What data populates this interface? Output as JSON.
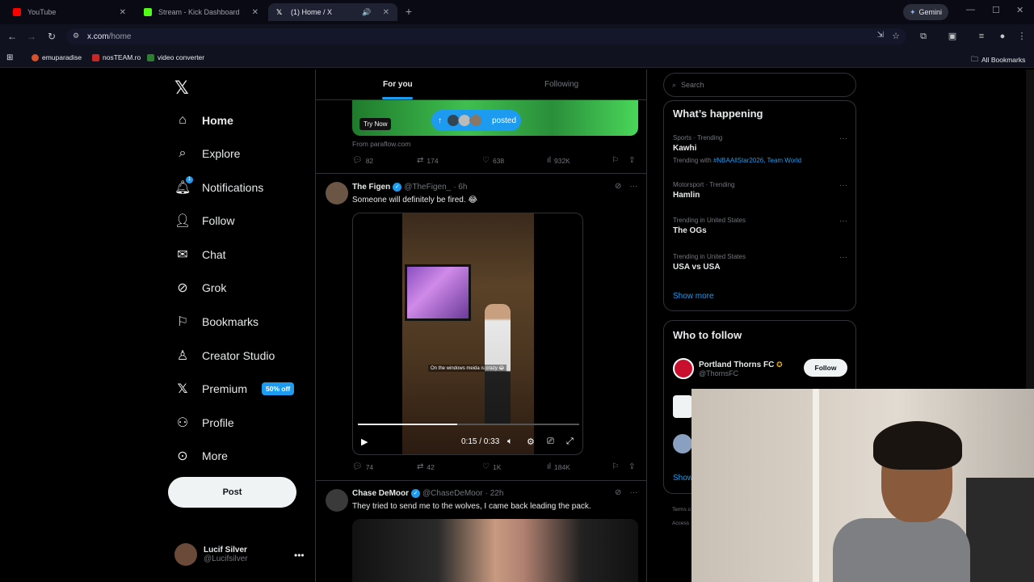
{
  "browser": {
    "tabs": [
      {
        "title": "YouTube",
        "fav_color": "#ff0000"
      },
      {
        "title": "Stream - Kick Dashboard",
        "fav_color": "#53fc18"
      },
      {
        "title": "(1) Home / X",
        "fav_color": "#ffffff"
      }
    ],
    "gemini_label": "Gemini",
    "url_host": "x.com",
    "url_path": "/home",
    "bookmarks": [
      "emuparadise",
      "nosTEAM.ro",
      "video converter"
    ],
    "all_bookmarks": "All Bookmarks"
  },
  "nav": {
    "items": [
      {
        "label": "Home",
        "icon": "home-icon"
      },
      {
        "label": "Explore",
        "icon": "search-icon"
      },
      {
        "label": "Notifications",
        "icon": "bell-icon",
        "badge": "1"
      },
      {
        "label": "Follow",
        "icon": "add-person-icon"
      },
      {
        "label": "Chat",
        "icon": "mail-icon"
      },
      {
        "label": "Grok",
        "icon": "grok-icon"
      },
      {
        "label": "Bookmarks",
        "icon": "bookmark-icon"
      },
      {
        "label": "Creator Studio",
        "icon": "creator-icon"
      },
      {
        "label": "Premium",
        "icon": "x-logo-icon",
        "promo": "50% off"
      },
      {
        "label": "Profile",
        "icon": "person-icon"
      },
      {
        "label": "More",
        "icon": "more-circle-icon"
      }
    ],
    "post_label": "Post",
    "account": {
      "name": "Lucif Silver",
      "handle": "@Lucifsilver"
    }
  },
  "feed": {
    "tabs": [
      "For you",
      "Following"
    ],
    "ad": {
      "try_now": "Try Now",
      "posted_label": "posted",
      "from": "From paraflow.com",
      "stats": {
        "replies": "82",
        "reposts": "174",
        "likes": "638",
        "views": "932K"
      }
    },
    "tweet1": {
      "name": "The Figen",
      "handle": "@TheFigen_",
      "time": "· 6h",
      "text": "Someone will definitely be fired. 😂",
      "video_caption": "On the windows meida is crazy 😂",
      "video_time": "0:15 / 0:33",
      "video_progress": 0.45,
      "stats": {
        "replies": "74",
        "reposts": "42",
        "likes": "1K",
        "views": "184K"
      }
    },
    "tweet2": {
      "name": "Chase DeMoor",
      "handle": "@ChaseDeMoor",
      "time": "· 22h",
      "text": "They tried to send me to the wolves, I came back leading the pack."
    }
  },
  "right": {
    "search_placeholder": "Search",
    "whats_happening": "What’s happening",
    "trends": [
      {
        "context": "Sports · Trending",
        "title": "Kawhi",
        "with_prefix": "Trending with ",
        "with_links": "#NBAAllStar2026, Team World"
      },
      {
        "context": "Motorsport · Trending",
        "title": "Hamlin"
      },
      {
        "context": "Trending in United States",
        "title": "The OGs"
      },
      {
        "context": "Trending in United States",
        "title": "USA vs USA"
      }
    ],
    "show_more": "Show more",
    "who_to_follow": "Who to follow",
    "suggestion": {
      "name": "Portland Thorns FC",
      "handle": "@ThornsFC",
      "button": "Follow"
    },
    "show_partial": "Show",
    "footer1": "Terms o",
    "footer2": "Access"
  }
}
